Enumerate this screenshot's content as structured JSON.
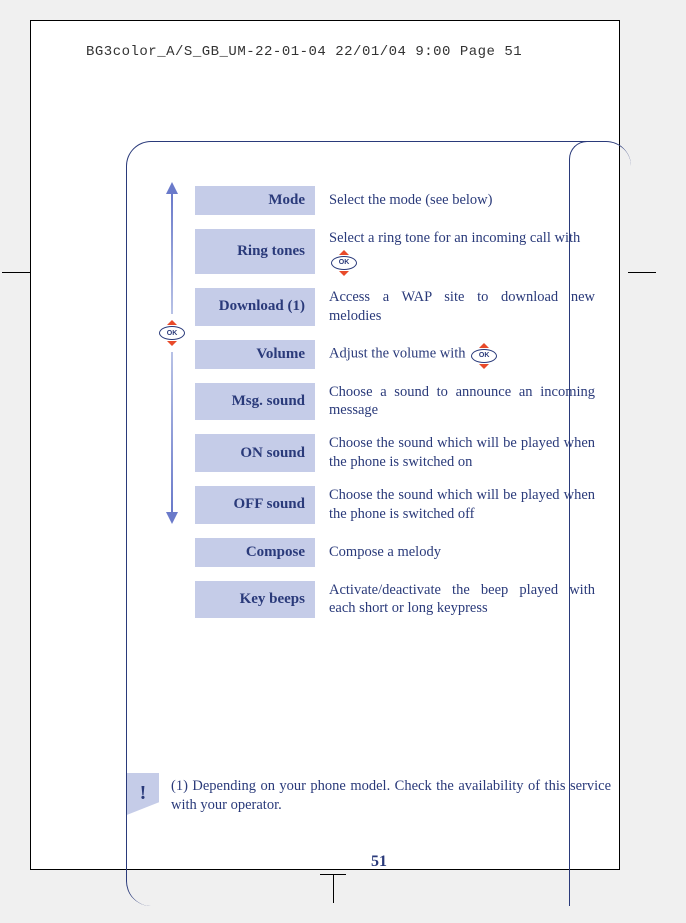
{
  "header": "BG3color_A/S_GB_UM-22-01-04  22/01/04  9:00  Page 51",
  "menu": [
    {
      "label": "Mode",
      "desc": "Select the mode (see below)"
    },
    {
      "label": "Ring tones",
      "desc": "Select a ring tone for an incoming call with",
      "has_ok_inline": true
    },
    {
      "label": "Download (1)",
      "desc": "Access a WAP site to download new melodies"
    },
    {
      "label": "Volume",
      "desc": "Adjust the volume with",
      "has_ok_inline_after": true
    },
    {
      "label": "Msg. sound",
      "desc": "Choose a sound to announce an incoming message"
    },
    {
      "label": "ON sound",
      "desc": "Choose the sound which will be played when the phone is switched on"
    },
    {
      "label": "OFF sound",
      "desc": "Choose the sound which will be played when the phone is switched off"
    },
    {
      "label": "Compose",
      "desc": "Compose a melody"
    },
    {
      "label": "Key beeps",
      "desc": "Activate/deactivate the beep played with each short or long keypress"
    }
  ],
  "ok_label": "OK",
  "footnote_marker": "!",
  "footnote_text": "(1) Depending on your phone model. Check the availability of this service with your operator.",
  "page_number": "51"
}
